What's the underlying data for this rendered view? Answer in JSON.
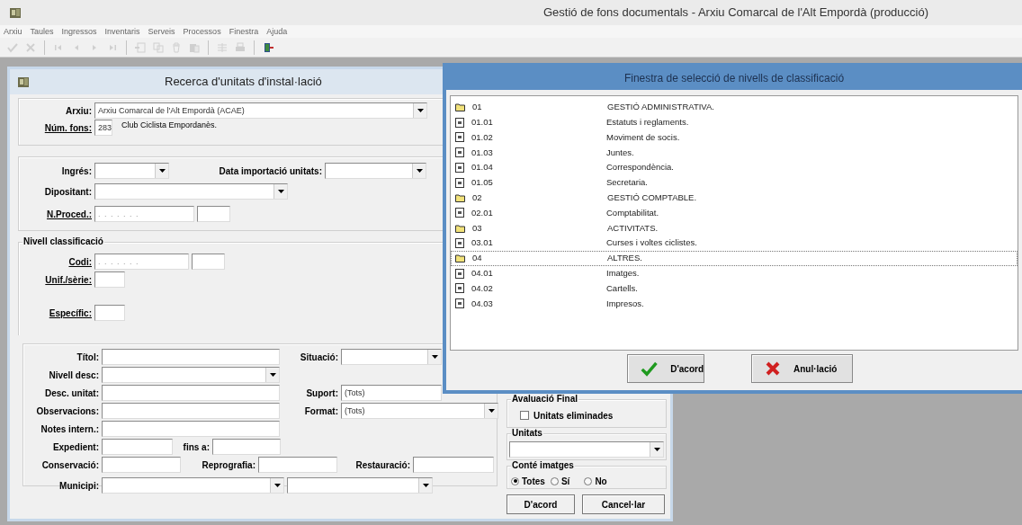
{
  "window": {
    "title": "Gestió de fons documentals - Arxiu Comarcal de l'Alt Empordà (producció)"
  },
  "menu": [
    "Arxiu",
    "Taules",
    "Ingressos",
    "Inventaris",
    "Serveis",
    "Processos",
    "Finestra",
    "Ajuda"
  ],
  "toolbar": [
    [
      {
        "kind": "accept",
        "disabled": true
      },
      {
        "kind": "cancel",
        "disabled": true
      }
    ],
    [
      {
        "kind": "first",
        "disabled": true
      },
      {
        "kind": "previous",
        "disabled": true
      },
      {
        "kind": "next",
        "disabled": true
      },
      {
        "kind": "last",
        "disabled": true
      }
    ],
    [
      {
        "kind": "new",
        "disabled": true
      },
      {
        "kind": "copy",
        "disabled": true
      },
      {
        "kind": "delete",
        "disabled": true
      },
      {
        "kind": "paste",
        "disabled": true
      }
    ],
    [
      {
        "kind": "list",
        "disabled": true
      },
      {
        "kind": "print",
        "disabled": true
      }
    ],
    [
      {
        "kind": "exit",
        "disabled": false
      }
    ]
  ],
  "search_dialog": {
    "title": "Recerca d'unitats d'instal·lació",
    "archive": {
      "label": "Arxiu:",
      "underlined": false,
      "value": "Arxiu Comarcal de l'Alt Empordà (ACAE)"
    },
    "fons": {
      "label": "Núm. fons:",
      "underlined": true,
      "value": "283",
      "name": "Club Ciclista Empordanès."
    },
    "entry": {
      "label": "Ingrés:",
      "underlined": false
    },
    "import_date": {
      "label": "Data importació unitats:"
    },
    "depositor": {
      "label": "Dipositant:",
      "underlined": false
    },
    "procedure": {
      "label": "N.Proced.:",
      "underlined": true,
      "placeholder": ". . . . . . ."
    },
    "classification": {
      "legend": "Nivell classificació",
      "code": {
        "label": "Codi:",
        "underlined": true,
        "placeholder": ". . . . . . ."
      },
      "unit_series": {
        "label": "Unif./sèrie:",
        "underlined": true
      },
      "specific": {
        "label": "Específic:",
        "underlined": true
      }
    },
    "details": {
      "title": {
        "label": "Títol:"
      },
      "situation": {
        "label": "Situació:"
      },
      "level_desc": {
        "label": "Nivell desc:"
      },
      "unit_desc": {
        "label": "Desc. unitat:"
      },
      "support": {
        "label": "Suport:",
        "value": "(Tots)"
      },
      "observations": {
        "label": "Observacions:"
      },
      "format": {
        "label": "Format:",
        "value": "(Tots)"
      },
      "internal_notes": {
        "label": "Notes intern.:"
      },
      "file": {
        "label": "Expedient:"
      },
      "until": {
        "label": "fins a:"
      },
      "conservation": {
        "label": "Conservació:"
      },
      "reprography": {
        "label": "Reprografia:"
      },
      "restoration": {
        "label": "Restauració:"
      },
      "municipality": {
        "label": "Municipi:"
      }
    },
    "final_evaluation": {
      "legend": "Avaluació Final",
      "removed_units": {
        "label": "Unitats eliminades",
        "checked": false
      }
    },
    "units": {
      "legend": "Unitats"
    },
    "images": {
      "legend": "Conté imatges",
      "options": [
        {
          "label": "Totes",
          "selected": true
        },
        {
          "label": "Sí",
          "selected": false
        },
        {
          "label": "No",
          "selected": false
        }
      ]
    },
    "buttons": [
      "D'acord",
      "Cancel·lar"
    ]
  },
  "selection_window": {
    "title": "Finestra de selecció de nivells de classificació",
    "rows": [
      {
        "kind": "folder",
        "code": "01",
        "description": "GESTIÓ ADMINISTRATIVA.",
        "selected": false
      },
      {
        "kind": "document",
        "code": "01.01",
        "description": "Estatuts i reglaments.",
        "selected": false
      },
      {
        "kind": "document",
        "code": "01.02",
        "description": "Moviment de socis.",
        "selected": false
      },
      {
        "kind": "document",
        "code": "01.03",
        "description": "Juntes.",
        "selected": false
      },
      {
        "kind": "document",
        "code": "01.04",
        "description": "Correspondència.",
        "selected": false
      },
      {
        "kind": "document",
        "code": "01.05",
        "description": "Secretaria.",
        "selected": false
      },
      {
        "kind": "folder",
        "code": "02",
        "description": "GESTIÓ COMPTABLE.",
        "selected": false
      },
      {
        "kind": "document",
        "code": "02.01",
        "description": "Comptabilitat.",
        "selected": false
      },
      {
        "kind": "folder",
        "code": "03",
        "description": "ACTIVITATS.",
        "selected": false
      },
      {
        "kind": "document",
        "code": "03.01",
        "description": "Curses i voltes ciclistes.",
        "selected": false
      },
      {
        "kind": "folder",
        "code": "04",
        "description": "ALTRES.",
        "selected": true
      },
      {
        "kind": "document",
        "code": "04.01",
        "description": "Imatges.",
        "selected": false
      },
      {
        "kind": "document",
        "code": "04.02",
        "description": "Cartells.",
        "selected": false
      },
      {
        "kind": "document",
        "code": "04.03",
        "description": "Impresos.",
        "selected": false
      }
    ],
    "buttons": [
      {
        "kind": "accept",
        "label": "D'acord"
      },
      {
        "kind": "cancel",
        "label": "Anul·lació"
      }
    ]
  }
}
